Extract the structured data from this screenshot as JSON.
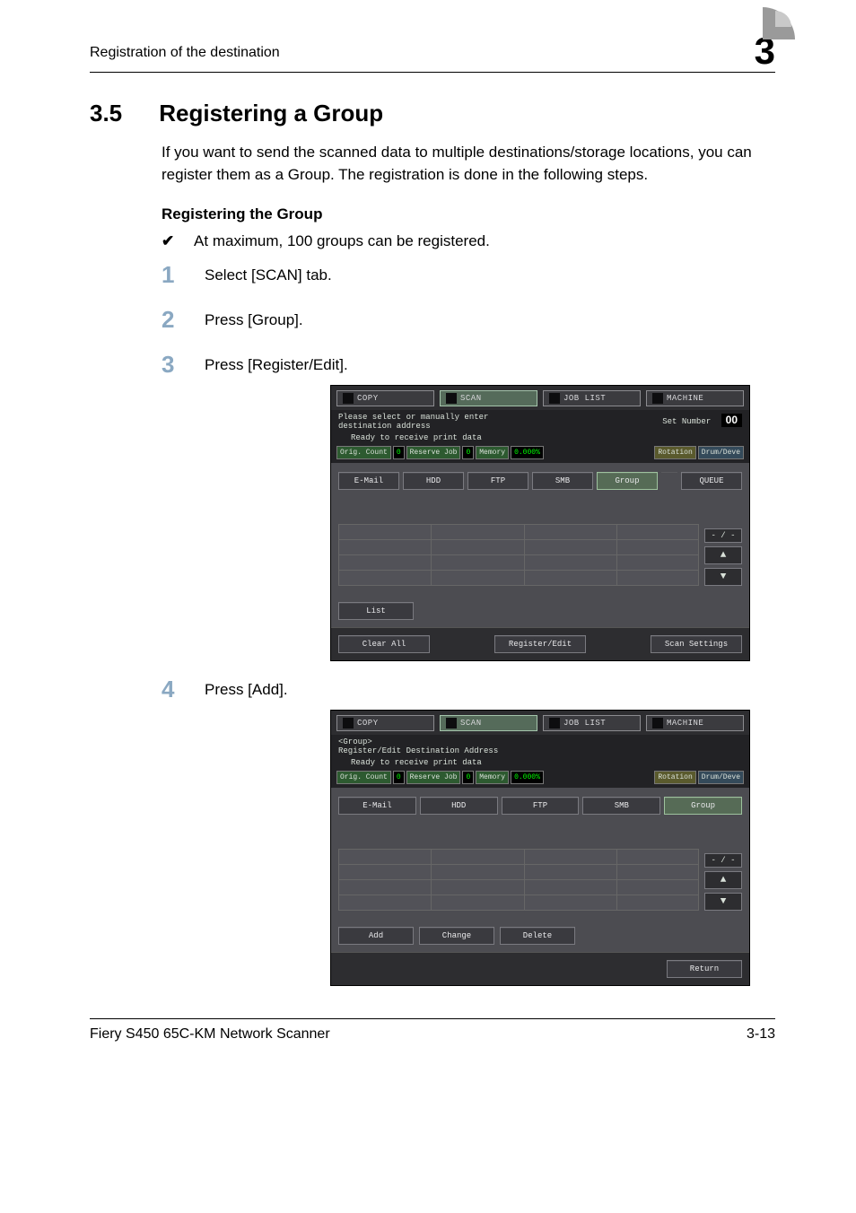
{
  "header": {
    "section_name": "Registration of the destination",
    "chapter_number": "3"
  },
  "section": {
    "number": "3.5",
    "title": "Registering a Group",
    "intro": "If you want to send the scanned data to multiple destinations/storage locations, you can register them as a Group. The registration is done in the following steps."
  },
  "subsection": {
    "heading": "Registering the Group",
    "checkmark_note": "At maximum, 100 groups can be registered."
  },
  "steps": [
    "Select [SCAN] tab.",
    "Press [Group].",
    "Press [Register/Edit].",
    "Press [Add]."
  ],
  "panel1": {
    "tabs": {
      "copy": "COPY",
      "scan": "SCAN",
      "joblist": "JOB LIST",
      "machine": "MACHINE"
    },
    "message_line1": "Please select or manually enter",
    "message_line2": "destination address",
    "set_number_label": "Set Number",
    "set_number_value": "00",
    "ready_line": "Ready to receive print data",
    "status": {
      "orig_count_label": "Orig. Count",
      "orig_count_val": "0",
      "reserve_label": "Reserve Job",
      "reserve_val": "0",
      "memory_label": "Memory",
      "memory_val": "0.000%",
      "rotation": "Rotation",
      "drum": "Drum/Deve"
    },
    "dest_tabs": {
      "email": "E-Mail",
      "hdd": "HDD",
      "ftp": "FTP",
      "smb": "SMB",
      "group": "Group",
      "queue": "QUEUE"
    },
    "page_indicator": "- / -",
    "list_btn": "List",
    "clear_all": "Clear All",
    "register_edit": "Register/Edit",
    "scan_settings": "Scan Settings"
  },
  "panel2": {
    "tabs": {
      "copy": "COPY",
      "scan": "SCAN",
      "joblist": "JOB LIST",
      "machine": "MACHINE"
    },
    "breadcrumb_line1": "<Group>",
    "breadcrumb_line2": "Register/Edit Destination Address",
    "ready_line": "Ready to receive print data",
    "status": {
      "orig_count_label": "Orig. Count",
      "orig_count_val": "0",
      "reserve_label": "Reserve Job",
      "reserve_val": "0",
      "memory_label": "Memory",
      "memory_val": "0.000%",
      "rotation": "Rotation",
      "drum": "Drum/Deve"
    },
    "dest_tabs": {
      "email": "E-Mail",
      "hdd": "HDD",
      "ftp": "FTP",
      "smb": "SMB",
      "group": "Group"
    },
    "page_indicator": "- / -",
    "add": "Add",
    "change": "Change",
    "delete": "Delete",
    "return": "Return"
  },
  "footer": {
    "product": "Fiery S450 65C-KM Network Scanner",
    "page": "3-13"
  }
}
